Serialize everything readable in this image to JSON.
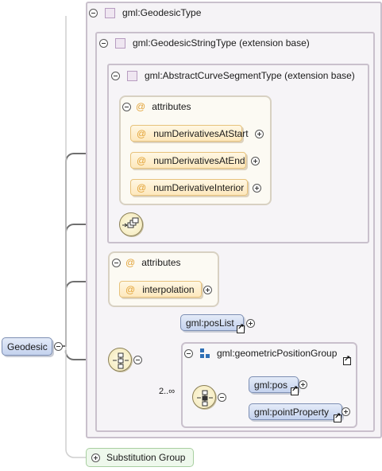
{
  "geodesic_type": {
    "label": "gml:GeodesicType"
  },
  "geodesic_string_type": {
    "label": "gml:GeodesicStringType (extension base)"
  },
  "abstract_curve_segment_type": {
    "label": "gml:AbstractCurveSegmentType (extension base)"
  },
  "attribute_group_1": {
    "header": "attributes",
    "items": [
      "numDerivativesAtStart",
      "numDerivativesAtEnd",
      "numDerivativeInterior"
    ]
  },
  "attribute_group_2": {
    "header": "attributes",
    "items": [
      "interpolation"
    ]
  },
  "sequence": {
    "pos_list": "gml:posList",
    "geometric_position_group": "gml:geometricPositionGroup",
    "choice_cardinality": "2..∞",
    "choice_items": [
      "gml:pos",
      "gml:pointProperty"
    ]
  },
  "root_element": {
    "label": "Geodesic"
  },
  "substitution_group": {
    "label": "Substitution Group"
  },
  "colors": {
    "type_border": "#c9c0cc",
    "attribute_accent": "#e2a235",
    "element_fill": "#c4d2ee",
    "substitution_fill": "#eef8ec",
    "group_icon": "#2e6fb5"
  }
}
